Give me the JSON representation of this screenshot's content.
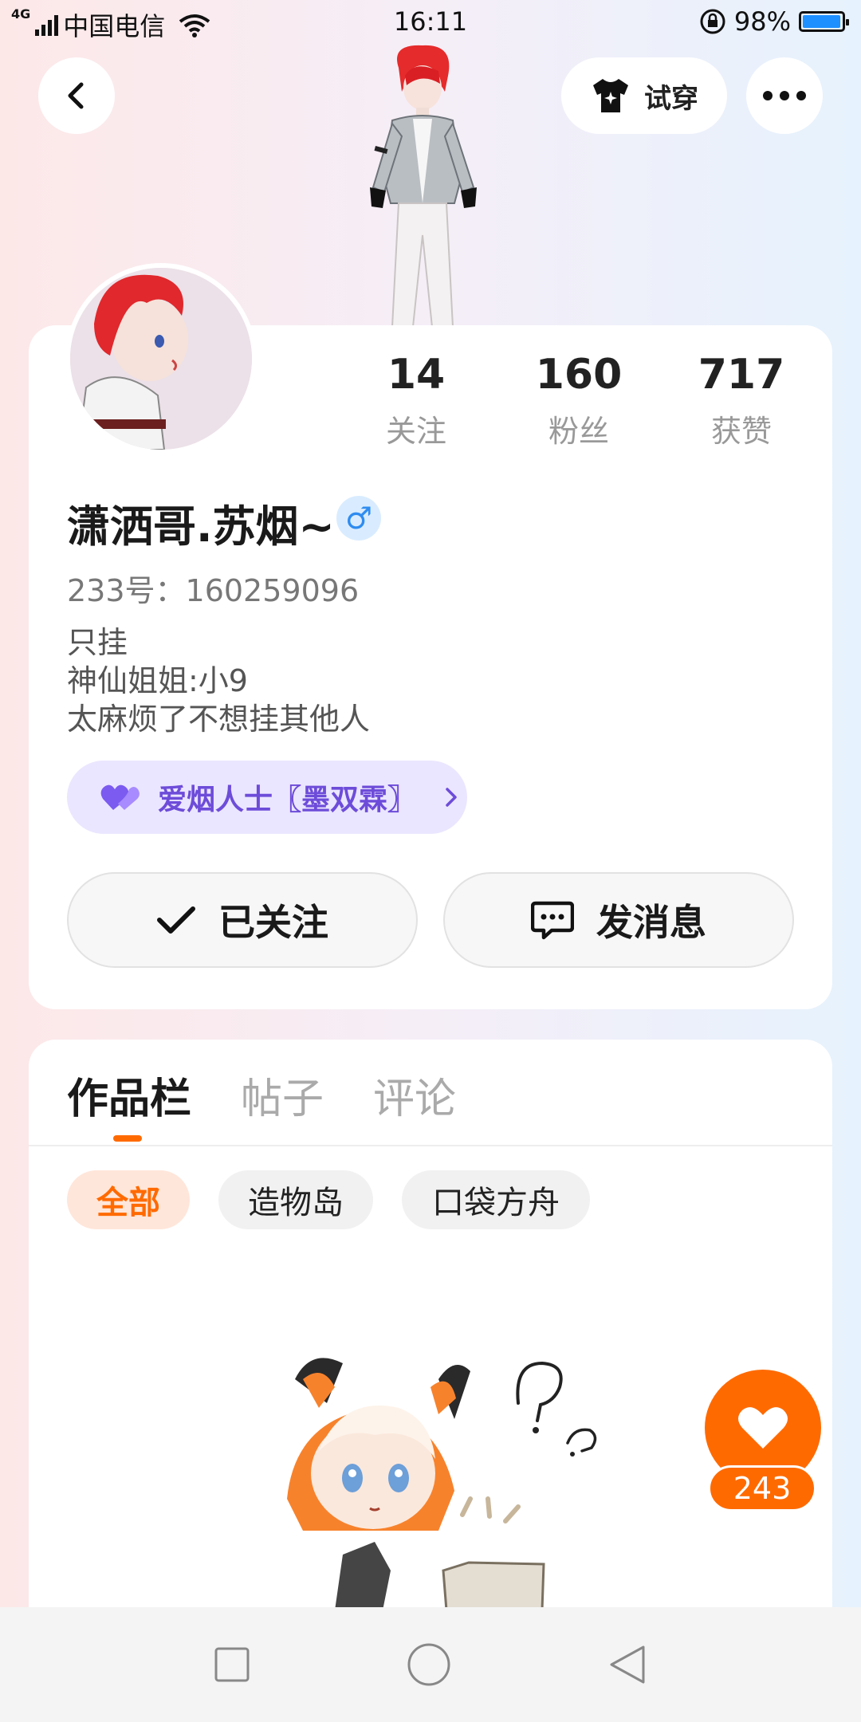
{
  "status_bar": {
    "network": "4G",
    "carrier": "中国电信",
    "time": "16:11",
    "battery_text": "98%",
    "battery_level": 0.98
  },
  "header": {
    "try_on_label": "试穿"
  },
  "profile": {
    "stats": [
      {
        "value": "14",
        "label": "关注"
      },
      {
        "value": "160",
        "label": "粉丝"
      },
      {
        "value": "717",
        "label": "获赞"
      }
    ],
    "name": "潇洒哥.苏烟~",
    "gender_symbol": "♂",
    "uid": "233号：160259096",
    "bio": [
      "只挂",
      "神仙姐姐:小9",
      "太麻烦了不想挂其他人"
    ],
    "badge_text": "爱烟人士〖墨双霖〗",
    "follow_label": "已关注",
    "message_label": "发消息"
  },
  "tabs": {
    "items": [
      "作品栏",
      "帖子",
      "评论"
    ],
    "active_index": 0
  },
  "filters": {
    "items": [
      "全部",
      "造物岛",
      "口袋方舟"
    ],
    "active_index": 0
  },
  "like": {
    "count": "243"
  },
  "colors": {
    "accent": "#ff6a00",
    "badge_text": "#6d4cd9",
    "badge_bg": "#ebe6ff",
    "gender": "#2f8cf0"
  },
  "icons": {
    "back": "chevron-left-icon",
    "shirt": "shirt-icon",
    "more": "more-icon",
    "check": "check-icon",
    "message": "chat-bubble-icon",
    "heart": "heart-icon"
  }
}
